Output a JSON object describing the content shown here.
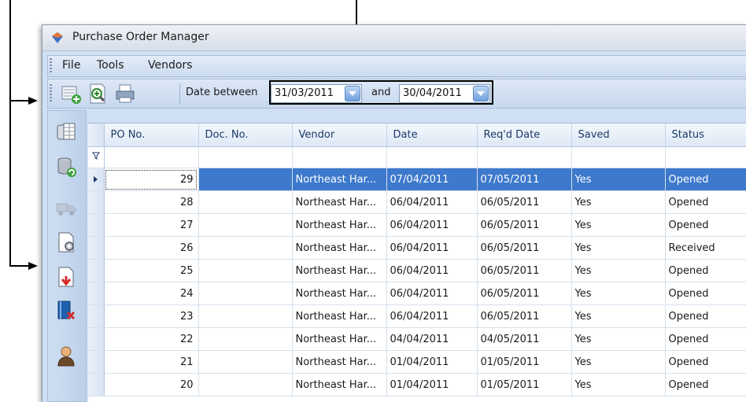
{
  "window": {
    "title": "Purchase Order Manager"
  },
  "menu": [
    "File",
    "Tools",
    "Vendors"
  ],
  "toolbar": {
    "date_label": "Date between",
    "date_from": "31/03/2011",
    "and_label": "and",
    "date_to": "30/04/2011",
    "buttons": [
      "new-order-icon",
      "zoom-in-icon",
      "print-icon"
    ]
  },
  "sidebar": [
    "grid-view-icon",
    "database-refresh-icon",
    "truck-icon",
    "document-settings-icon",
    "document-export-icon",
    "delete-book-icon",
    "user-icon"
  ],
  "grid": {
    "columns": [
      "PO No.",
      "Doc. No.",
      "Vendor",
      "Date",
      "Req'd Date",
      "Saved",
      "Status"
    ],
    "rows": [
      {
        "po": "29",
        "doc": "",
        "vendor": "Northeast Har...",
        "date": "07/04/2011",
        "reqd": "07/05/2011",
        "saved": "Yes",
        "status": "Opened"
      },
      {
        "po": "28",
        "doc": "",
        "vendor": "Northeast Har...",
        "date": "06/04/2011",
        "reqd": "06/05/2011",
        "saved": "Yes",
        "status": "Opened"
      },
      {
        "po": "27",
        "doc": "",
        "vendor": "Northeast Har...",
        "date": "06/04/2011",
        "reqd": "06/05/2011",
        "saved": "Yes",
        "status": "Opened"
      },
      {
        "po": "26",
        "doc": "",
        "vendor": "Northeast Har...",
        "date": "06/04/2011",
        "reqd": "06/05/2011",
        "saved": "Yes",
        "status": "Received"
      },
      {
        "po": "25",
        "doc": "",
        "vendor": "Northeast Har...",
        "date": "06/04/2011",
        "reqd": "06/05/2011",
        "saved": "Yes",
        "status": "Opened"
      },
      {
        "po": "24",
        "doc": "",
        "vendor": "Northeast Har...",
        "date": "06/04/2011",
        "reqd": "06/05/2011",
        "saved": "Yes",
        "status": "Opened"
      },
      {
        "po": "23",
        "doc": "",
        "vendor": "Northeast Har...",
        "date": "06/04/2011",
        "reqd": "06/05/2011",
        "saved": "Yes",
        "status": "Opened"
      },
      {
        "po": "22",
        "doc": "",
        "vendor": "Northeast Har...",
        "date": "04/04/2011",
        "reqd": "04/05/2011",
        "saved": "Yes",
        "status": "Opened"
      },
      {
        "po": "21",
        "doc": "",
        "vendor": "Northeast Har...",
        "date": "01/04/2011",
        "reqd": "01/05/2011",
        "saved": "Yes",
        "status": "Opened"
      },
      {
        "po": "20",
        "doc": "",
        "vendor": "Northeast Har...",
        "date": "01/04/2011",
        "reqd": "01/05/2011",
        "saved": "Yes",
        "status": "Opened"
      }
    ]
  },
  "colors": {
    "selection": "#3d79cc",
    "header_text": "#1b3a66",
    "chrome": "#cfe0f4"
  }
}
